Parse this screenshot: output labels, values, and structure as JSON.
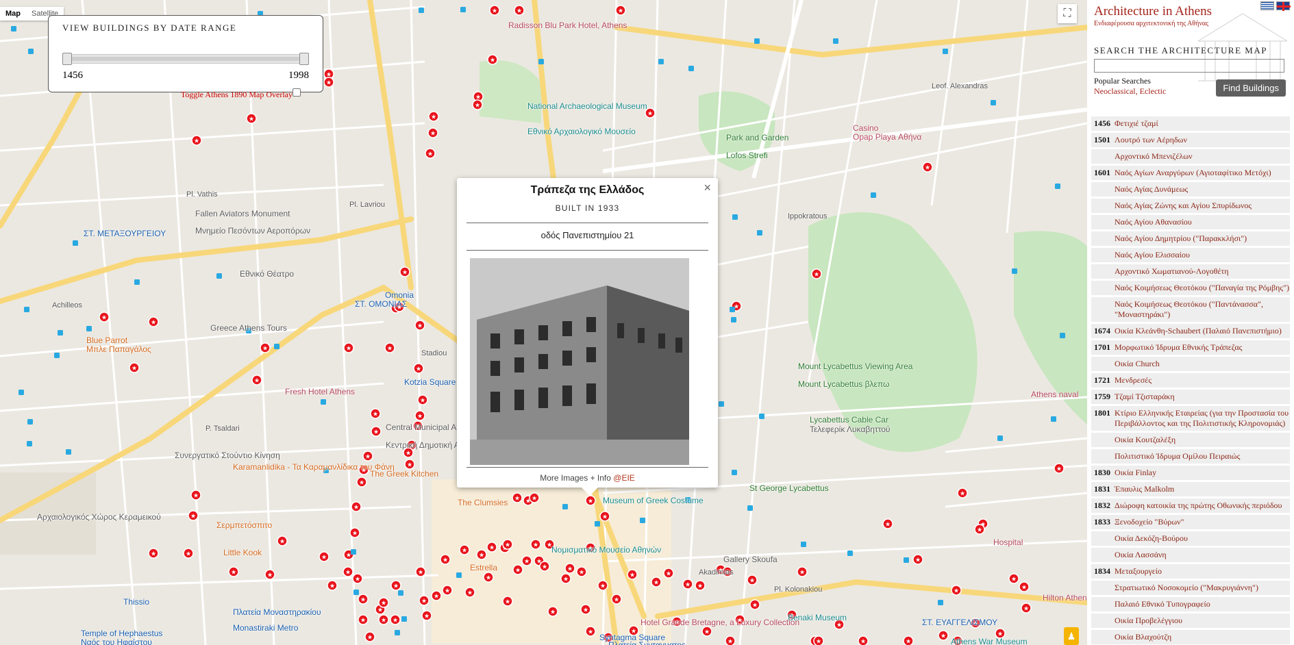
{
  "map": {
    "map_type": [
      "Map",
      "Satellite"
    ],
    "active_type": "Map",
    "labels": [
      "Πλατεία Μοναστηρακίου",
      "Syntagma Square",
      "Πλατεία Συνταγματος",
      "Omonia",
      "ΣΤ. ΟΜΟΝΙΑΣ",
      "National Archaeological Museum",
      "Εθνικό Αρχαιολογικό Μουσείο",
      "Park and Garden",
      "Lofos Strefi",
      "Mount Lycabettus Viewing Area",
      "Mount Lycabettus βλεπω",
      "Lycabettus Cable Car",
      "Τελεφερίκ Λυκαβηττού",
      "Benaki Museum",
      "Pl. Kolonakiou",
      "Hospital",
      "Fallen Aviators Monument",
      "Μνημείο Πεσόντων Αεροπόρων",
      "ΣΤ. ΜΕΤΑΞΟΥΡΓΕΙΟΥ",
      "Εθνικό Θέατρο",
      "Greece Athens Tours",
      "Blue Parrot",
      "Μπλε Παπαγάλος",
      "Fresh Hotel Athens",
      "Central Municipal Athens Market",
      "Κεντρική Δημοτική Αγορά Αθηνας",
      "The Greek Kitchen",
      "Karamanlidika - Τα Καραμανλίδικα του Φάνη",
      "Σερμπετόσπιτο",
      "Little Kook",
      "Estrella",
      "Αρχαιολογικός Χώρος Κεραμεικού",
      "Thissio",
      "Monastiraki Metro",
      "Temple of Hephaestus",
      "Ναός του Ηφαίστου",
      "Radisson Blu Park Hotel, Athens",
      "Casino",
      "Opap Playa Αθήνα",
      "Νομισματικό Μουσείο Αθηνών",
      "Gallery Skoufa",
      "St George Lycabettus",
      "Athens War Museum",
      "Hilton Athens",
      "Athens naval",
      "ΣΤ. ΕΥΑΓΓΕΛΙΣΜΟΥ",
      "Museum of Greek Costume",
      "The Clumsies",
      "Kotzia Square",
      "Hotel Grande Bretagne, a Luxury Collection",
      "Pl. Vathis",
      "Pl. Lavriou",
      "Achilleos",
      "P. Tsaldari",
      "Leof. Alexandras",
      "Stadiou",
      "Ippokratous",
      "Akadimias",
      "Συνεργατικό Στούντιο Κίνηση"
    ]
  },
  "date_filter": {
    "title": "VIEW BUILDINGS BY DATE RANGE",
    "min": "1456",
    "max": "1998",
    "toggle_label": "Toggle Athens 1890 Map Overlay"
  },
  "popup": {
    "name": "Τράπεζα της Ελλάδος",
    "built": "BUILT IN 1933",
    "address": "οδός Πανεπιστημίου 21",
    "more_prefix": "More Images + Info ",
    "more_link": "@EIE",
    "close_icon": "close-icon"
  },
  "sidebar": {
    "title": "Architecture in Athens",
    "subtitle": "Ενδιαφέρουσα αρχιτεκτονική της Αθήνας",
    "search_title": "SEARCH THE ARCHITECTURE MAP",
    "search_value": "",
    "popular_label": "Popular Searches",
    "popular_links": "Neoclassical, Eclectic",
    "find_button": "Find Buildings",
    "buildings": [
      {
        "year": "1456",
        "name": "Φετιχιέ τζαμί"
      },
      {
        "year": "1501",
        "name": "Λουτρό των Αέρηδων"
      },
      {
        "year": "",
        "name": "Αρχοντικό Μπενιζέλων"
      },
      {
        "year": "1601",
        "name": "Ναός Αγίων Αναργύρων (Αγιοταφίτικο Μετόχι)"
      },
      {
        "year": "",
        "name": "Ναός Αγίας Δυνάμεως"
      },
      {
        "year": "",
        "name": "Ναός Αγίας Ζώνης και Αγίου Σπυρίδωνος"
      },
      {
        "year": "",
        "name": "Ναός Αγίου Αθανασίου"
      },
      {
        "year": "",
        "name": "Ναός Αγίου Δημητρίου (\"Παρακκλήσι\")"
      },
      {
        "year": "",
        "name": "Ναός Αγίου Ελισσαίου"
      },
      {
        "year": "",
        "name": "Αρχοντικό Χωματιανού-Λογοθέτη"
      },
      {
        "year": "",
        "name": "Ναός Κοιμήσεως Θεοτόκου (\"Παναγία της Ρόμβης\")"
      },
      {
        "year": "",
        "name": "Ναός Κοιμήσεως Θεοτόκου (\"Παντάνασσα\", \"Μοναστηράκι\")"
      },
      {
        "year": "1674",
        "name": "Οικία Κλεάνθη-Schaubert (Παλαιό Πανεπιστήμιο)"
      },
      {
        "year": "1701",
        "name": "Μορφωτικό Ίδρυμα Εθνικής Τράπεζας"
      },
      {
        "year": "",
        "name": "Οικία Church"
      },
      {
        "year": "1721",
        "name": "Μενδρεσές"
      },
      {
        "year": "1759",
        "name": "Τζαμί Τζισταράκη"
      },
      {
        "year": "1801",
        "name": "Κτίριο Ελληνικής Εταιρείας (για την Προστασία του Περιβάλλοντος και της Πολιτιστικής Κληρονομιάς)"
      },
      {
        "year": "",
        "name": "Οικία Κουτζαλέξη"
      },
      {
        "year": "",
        "name": "Πολιτιστικό Ίδρυμα Ομίλου Πειραιώς"
      },
      {
        "year": "1830",
        "name": "Οικία Finlay"
      },
      {
        "year": "1831",
        "name": "Έπαυλις Malkolm"
      },
      {
        "year": "1832",
        "name": "Διώροφη κατοικία της πρώτης Οθωνικής περιόδου"
      },
      {
        "year": "1833",
        "name": "Ξενοδοχείο \"Βύρων\""
      },
      {
        "year": "",
        "name": "Οικία Δεκόζη-Βούρου"
      },
      {
        "year": "",
        "name": "Οικία Λασσάνη"
      },
      {
        "year": "1834",
        "name": "Μεταξουργείο"
      },
      {
        "year": "",
        "name": "Στρατιωτικό Νοσοκομείο (\"Μακρυγιάννη\")"
      },
      {
        "year": "",
        "name": "Παλαιό Εθνικό Τυπογραφείο"
      },
      {
        "year": "",
        "name": "Οικία Προβελέγγιου"
      },
      {
        "year": "",
        "name": "Οικία Βλαχούτζη"
      }
    ]
  },
  "colors": {
    "marker": "#e8141c",
    "accent": "#a4231a",
    "road_major": "#f8d77a",
    "park": "#c8e6bf"
  }
}
